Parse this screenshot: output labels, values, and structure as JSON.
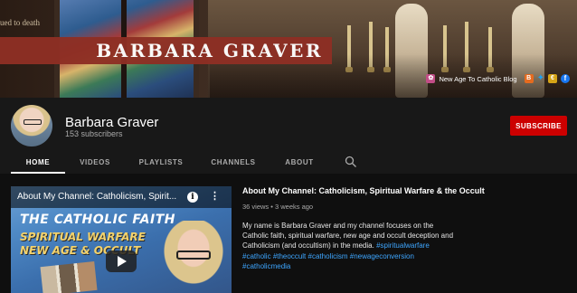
{
  "banner": {
    "channel_name": "BARBARA GRAVER",
    "left_note": "ued to death",
    "links": {
      "main_label": "New Age To Catholic Blog",
      "icons": [
        "link-icon",
        "blogger-icon",
        "twitter-icon",
        "coin-icon",
        "facebook-icon"
      ]
    },
    "strip_color": "#8e2f24"
  },
  "header": {
    "channel_title": "Barbara Graver",
    "subscribers": "153 subscribers",
    "subscribe_label": "SUBSCRIBE",
    "subscribe_color": "#cc0000"
  },
  "tabs": [
    {
      "label": "HOME",
      "active": true
    },
    {
      "label": "VIDEOS",
      "active": false
    },
    {
      "label": "PLAYLISTS",
      "active": false
    },
    {
      "label": "CHANNELS",
      "active": false
    },
    {
      "label": "ABOUT",
      "active": false
    }
  ],
  "featured_video": {
    "player_title": "About My Channel: Catholicism, Spirit...",
    "thumbnail_lines": [
      "THE CATHOLIC FAITH",
      "SPIRITUAL WARFARE",
      "NEW AGE & OCCULT"
    ],
    "title": "About My Channel: Catholicism, Spiritual Warfare & the Occult",
    "stats": "36 views • 3 weeks ago",
    "description": "My name is Barbara Graver and my channel focuses on the Catholic faith, spiritual warfare, new age and occult deception and Catholicism (and occultism) in the media.",
    "hashtags": [
      "#spiritualwarfare",
      "#catholic",
      "#theoccult",
      "#catholicism",
      "#newageconversion",
      "#catholicmedia"
    ]
  },
  "colors": {
    "page_bg": "#181818",
    "content_bg": "#0f0f0f",
    "link_blue": "#3ea6ff",
    "muted_text": "#aaaaaa"
  }
}
